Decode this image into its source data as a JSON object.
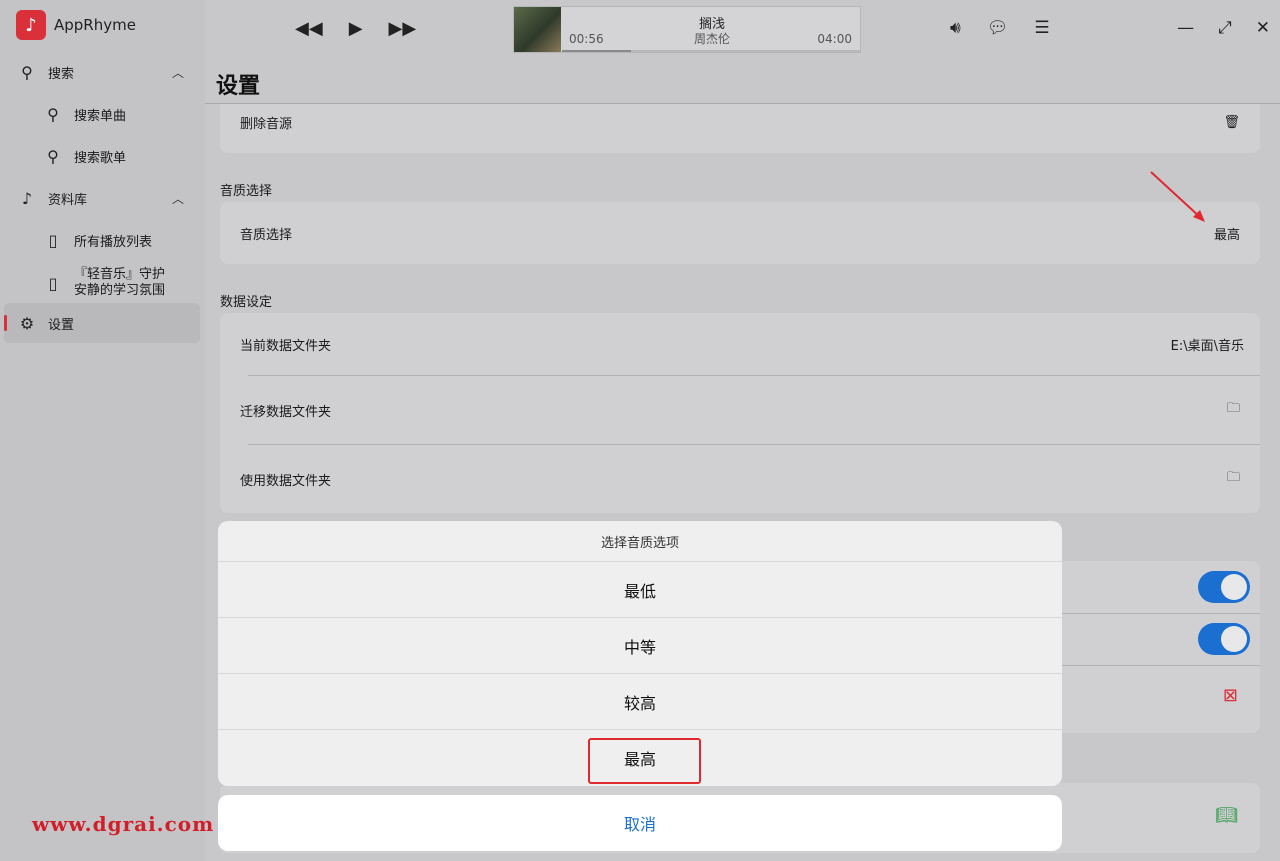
{
  "app": {
    "name": "AppRhyme",
    "logo_icon": "music-note-icon",
    "accent_color": "#d9303a"
  },
  "sidebar": {
    "search": {
      "label": "搜索",
      "icon": "search-icon"
    },
    "search_single": {
      "label": "搜索单曲",
      "icon": "search-icon"
    },
    "search_playlist": {
      "label": "搜索歌单",
      "icon": "search-icon"
    },
    "library": {
      "label": "资料库",
      "icon": "music-note-icon"
    },
    "all_playlists": {
      "label": "所有播放列表",
      "icon": "playlist-icon"
    },
    "playlist_light_1": {
      "label": "『轻音乐』守护",
      "icon": "playlist-icon"
    },
    "playlist_light_2": {
      "label": "安静的学习氛围"
    },
    "settings": {
      "label": "设置",
      "icon": "settings-icon"
    }
  },
  "player": {
    "title": "搁浅",
    "artist": "周杰伦",
    "time_current": "00:56",
    "time_total": "04:00",
    "progress_fraction": 0.23
  },
  "page": {
    "title": "设置"
  },
  "settings": {
    "delete_source_label": "删除音源",
    "quality_section": "音质选择",
    "quality_label": "音质选择",
    "quality_value": "最高",
    "data_section": "数据设定",
    "current_folder_label": "当前数据文件夹",
    "current_folder_value": "E:\\桌面\\音乐",
    "migrate_folder_label": "迁移数据文件夹",
    "use_folder_label": "使用数据文件夹"
  },
  "sheet": {
    "title": "选择音质选项",
    "options": [
      "最低",
      "中等",
      "较高",
      "最高"
    ],
    "cancel": "取消"
  },
  "watermark": "www.dgrai.com"
}
